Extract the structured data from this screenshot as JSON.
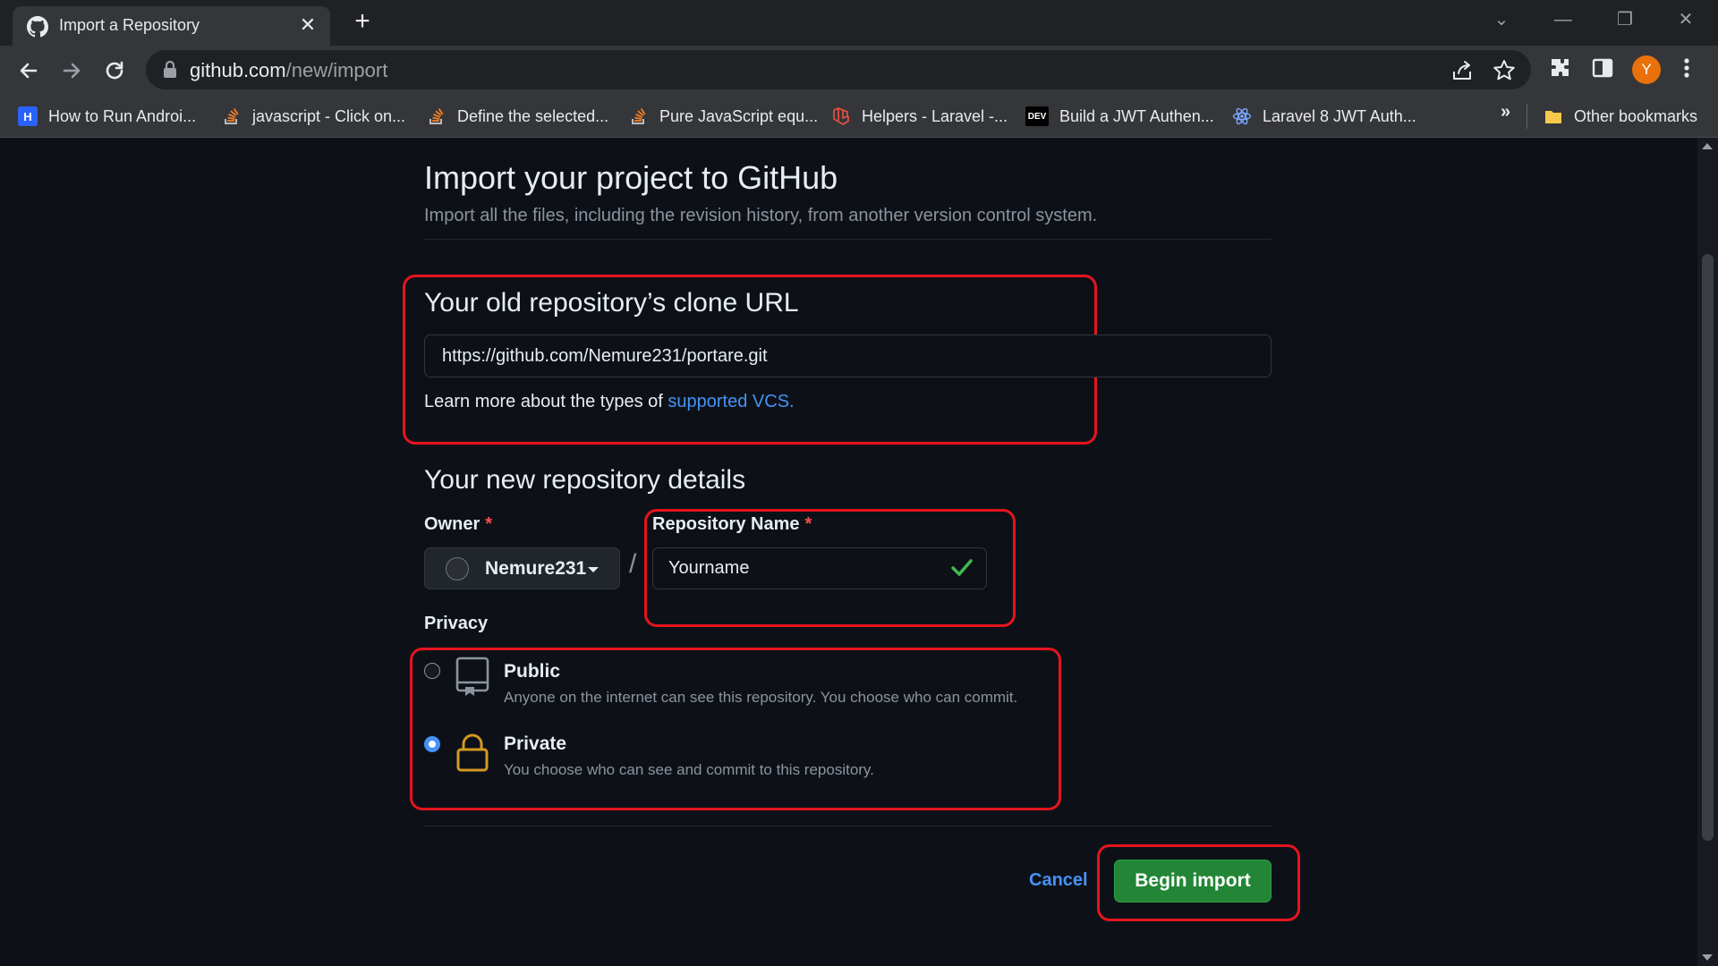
{
  "browser": {
    "tab_title": "Import a Repository",
    "url_host": "github.com",
    "url_path": "/new/import",
    "avatar_letter": "Y",
    "accent_color": "#e8710a",
    "bookmarks": [
      {
        "label": "How to Run Androi...",
        "icon": "hashnode-icon"
      },
      {
        "label": "javascript - Click on...",
        "icon": "stackoverflow-icon"
      },
      {
        "label": "Define the selected...",
        "icon": "stackoverflow-icon"
      },
      {
        "label": "Pure JavaScript equ...",
        "icon": "stackoverflow-icon"
      },
      {
        "label": "Helpers - Laravel -...",
        "icon": "laravel-icon"
      },
      {
        "label": "Build a JWT Authen...",
        "icon": "dev-icon"
      },
      {
        "label": "Laravel 8 JWT Auth...",
        "icon": "react-icon"
      }
    ],
    "bookmarks_more": "»",
    "other_bookmarks": "Other bookmarks"
  },
  "page": {
    "title": "Import your project to GitHub",
    "subtitle": "Import all the files, including the revision history, from another version control system.",
    "clone": {
      "heading": "Your old repository’s clone URL",
      "value": "https://github.com/Nemure231/portare.git",
      "learn_prefix": "Learn more about the types of",
      "learn_link": "supported VCS."
    },
    "details": {
      "heading": "Your new repository details",
      "owner_label": "Owner",
      "owner_value": "Nemure231",
      "repo_label": "Repository Name",
      "repo_value": "Yourname",
      "required_mark": "*",
      "separator": "/"
    },
    "privacy": {
      "label": "Privacy",
      "options": [
        {
          "title": "Public",
          "desc": "Anyone on the internet can see this repository. You choose who can commit.",
          "selected": false
        },
        {
          "title": "Private",
          "desc": "You choose who can see and commit to this repository.",
          "selected": true
        }
      ]
    },
    "actions": {
      "cancel": "Cancel",
      "submit": "Begin import"
    }
  },
  "colors": {
    "highlight_box": "#e5141f",
    "link": "#4493f8",
    "submit_bg": "#238636",
    "private_lock": "#d29922"
  }
}
